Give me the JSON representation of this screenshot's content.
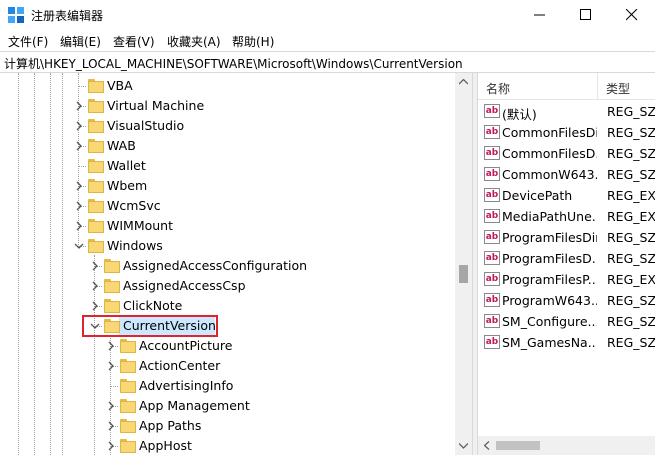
{
  "window": {
    "title": "注册表编辑器",
    "controls": {
      "minimize": "minimize-icon",
      "maximize": "maximize-icon",
      "close": "close-icon"
    }
  },
  "menu": [
    "文件(F)",
    "编辑(E)",
    "查看(V)",
    "收藏夹(A)",
    "帮助(H)"
  ],
  "address": "计算机\\HKEY_LOCAL_MACHINE\\SOFTWARE\\Microsoft\\Windows\\CurrentVersion",
  "tree": {
    "items": [
      {
        "label": "VBA",
        "expander": "none"
      },
      {
        "label": "Virtual Machine",
        "expander": "collapsed"
      },
      {
        "label": "VisualStudio",
        "expander": "collapsed"
      },
      {
        "label": "WAB",
        "expander": "collapsed"
      },
      {
        "label": "Wallet",
        "expander": "none"
      },
      {
        "label": "Wbem",
        "expander": "collapsed"
      },
      {
        "label": "WcmSvc",
        "expander": "collapsed"
      },
      {
        "label": "WIMMount",
        "expander": "collapsed"
      },
      {
        "label": "Windows",
        "expander": "expanded"
      },
      {
        "label": "AssignedAccessConfiguration",
        "expander": "collapsed"
      },
      {
        "label": "AssignedAccessCsp",
        "expander": "collapsed"
      },
      {
        "label": "ClickNote",
        "expander": "collapsed"
      },
      {
        "label": "CurrentVersion",
        "expander": "expanded",
        "selected": true
      },
      {
        "label": "AccountPicture",
        "expander": "collapsed"
      },
      {
        "label": "ActionCenter",
        "expander": "collapsed"
      },
      {
        "label": "AdvertisingInfo",
        "expander": "none"
      },
      {
        "label": "App Management",
        "expander": "collapsed"
      },
      {
        "label": "App Paths",
        "expander": "collapsed"
      },
      {
        "label": "AppHost",
        "expander": "collapsed"
      }
    ],
    "highlight_color": "#e0242e",
    "folder_color": "#f8d775"
  },
  "values": {
    "headers": {
      "name": "名称",
      "type": "类型"
    },
    "rows": [
      {
        "name": "(默认)",
        "type": "REG_SZ"
      },
      {
        "name": "CommonFilesDir",
        "type": "REG_SZ"
      },
      {
        "name": "CommonFilesD...",
        "type": "REG_SZ"
      },
      {
        "name": "CommonW643...",
        "type": "REG_SZ"
      },
      {
        "name": "DevicePath",
        "type": "REG_EXI"
      },
      {
        "name": "MediaPathUne...",
        "type": "REG_EXI"
      },
      {
        "name": "ProgramFilesDir",
        "type": "REG_SZ"
      },
      {
        "name": "ProgramFilesD...",
        "type": "REG_SZ"
      },
      {
        "name": "ProgramFilesP...",
        "type": "REG_EXI"
      },
      {
        "name": "ProgramW643...",
        "type": "REG_SZ"
      },
      {
        "name": "SM_Configure...",
        "type": "REG_SZ"
      },
      {
        "name": "SM_GamesNa...",
        "type": "REG_SZ"
      }
    ],
    "value_icon_text": "ab",
    "value_icon": "string-value-icon"
  }
}
